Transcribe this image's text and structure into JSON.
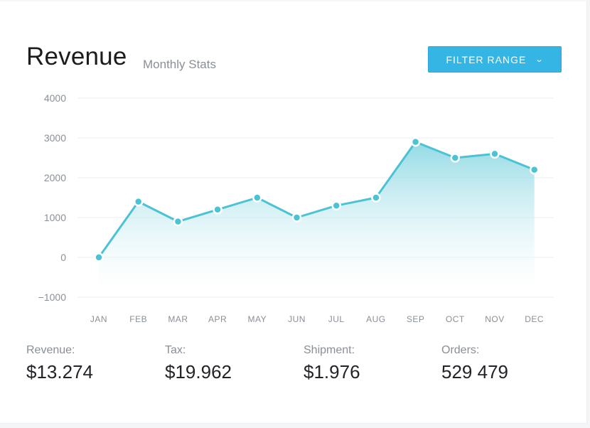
{
  "header": {
    "title": "Revenue",
    "subtitle": "Monthly Stats",
    "filter_label": "FILTER RANGE"
  },
  "colors": {
    "accent": "#35b5e4",
    "line": "#4bc3d4",
    "grid": "#eceef1"
  },
  "chart_data": {
    "type": "area",
    "categories": [
      "JAN",
      "FEB",
      "MAR",
      "APR",
      "MAY",
      "JUN",
      "JUL",
      "AUG",
      "SEP",
      "OCT",
      "NOV",
      "DEC"
    ],
    "series": [
      {
        "values": [
          0,
          1400,
          900,
          1200,
          1500,
          1000,
          1300,
          1500,
          2900,
          2500,
          2600,
          2200
        ]
      }
    ],
    "y_ticks": [
      "4000",
      "3000",
      "2000",
      "1000",
      "0",
      "−1000"
    ],
    "y_tick_values": [
      4000,
      3000,
      2000,
      1000,
      0,
      -1000
    ],
    "ylim": [
      -1000,
      4000
    ],
    "grid": true,
    "legend": "none"
  },
  "stats": [
    {
      "label": "Revenue:",
      "value": "$13.274"
    },
    {
      "label": "Tax:",
      "value": "$19.962"
    },
    {
      "label": "Shipment:",
      "value": "$1.976"
    },
    {
      "label": "Orders:",
      "value": "529 479"
    }
  ]
}
